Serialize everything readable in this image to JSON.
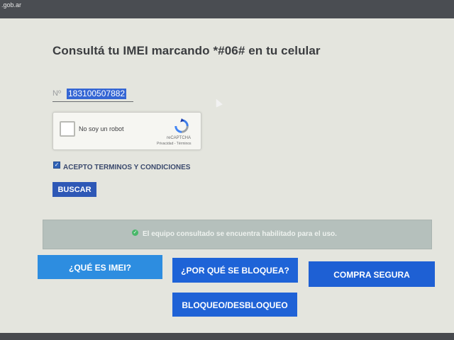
{
  "browser": {
    "url": ".gob.ar"
  },
  "page": {
    "title": "Consultá tu IMEI marcando *#06# en tu celular"
  },
  "imei_input": {
    "prefix": "Nº",
    "value": "183100507882"
  },
  "recaptcha": {
    "label": "No soy un robot",
    "brand": "reCAPTCHA",
    "links": "Privacidad - Términos"
  },
  "terms": {
    "label": "ACEPTO TERMINOS Y CONDICIONES",
    "checked": true
  },
  "search_button": {
    "label": "BUSCAR"
  },
  "status_message": {
    "text": "El equipo consultado se encuentra habilitado para el uso."
  },
  "nav_buttons": {
    "what_is_imei": "¿QUÉ ES IMEI?",
    "why_blocked": "¿POR QUÉ SE BLOQUEA?",
    "safe_purchase": "COMPRA SEGURA",
    "block_unblock": "BLOQUEO/DESBLOQUEO"
  },
  "colors": {
    "primary_button": "#1e63d7",
    "light_button": "#2d8de0",
    "status_ok": "#49b86a"
  }
}
